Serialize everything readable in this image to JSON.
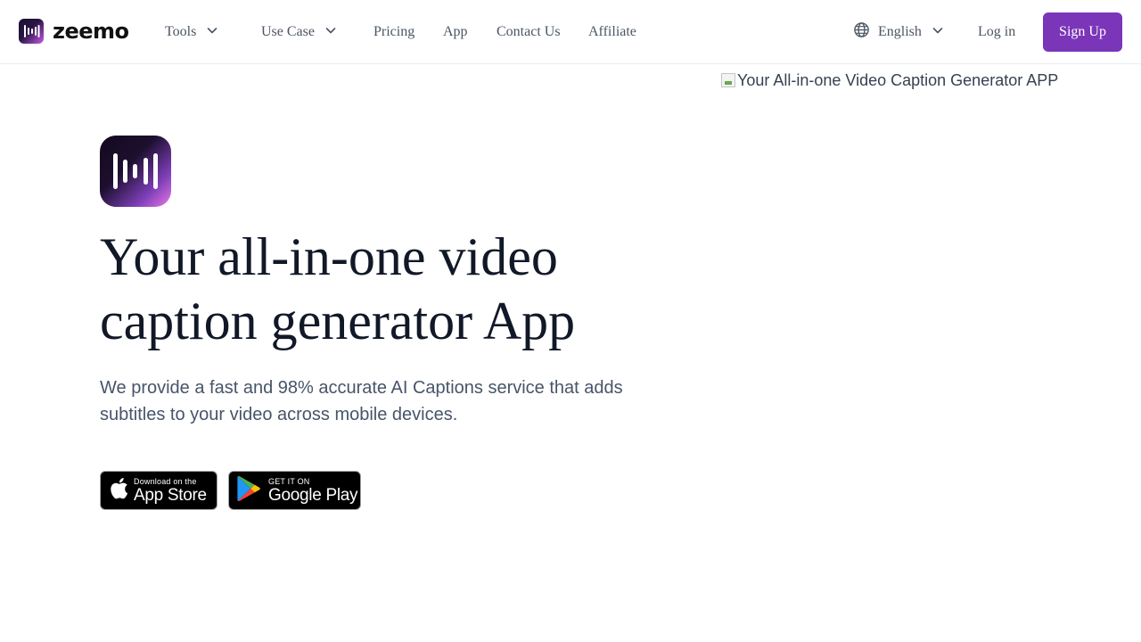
{
  "brand": {
    "name": "zeemo",
    "accent": "#7b35b8"
  },
  "nav": {
    "items": [
      {
        "label": "Tools",
        "has_dropdown": true
      },
      {
        "label": "Use Case",
        "has_dropdown": true
      },
      {
        "label": "Pricing",
        "has_dropdown": false
      },
      {
        "label": "App",
        "has_dropdown": false
      },
      {
        "label": "Contact Us",
        "has_dropdown": false
      },
      {
        "label": "Affiliate",
        "has_dropdown": false
      }
    ],
    "language": "English",
    "login": "Log in",
    "signup": "Sign Up"
  },
  "hero": {
    "title_line1": "Your all-in-one video",
    "title_line2": "caption generator App",
    "description": "We provide a fast and 98% accurate AI Captions service that adds subtitles to your video across mobile devices.",
    "app_store": {
      "small": "Download on the",
      "big": "App Store"
    },
    "google_play": {
      "small": "GET IT ON",
      "big": "Google Play"
    },
    "image_alt": "Your All-in-one Video Caption Generator APP"
  },
  "icons": {
    "globe": "globe-icon",
    "chevron": "chevron-down-icon",
    "apple": "apple-icon",
    "play": "google-play-icon"
  }
}
